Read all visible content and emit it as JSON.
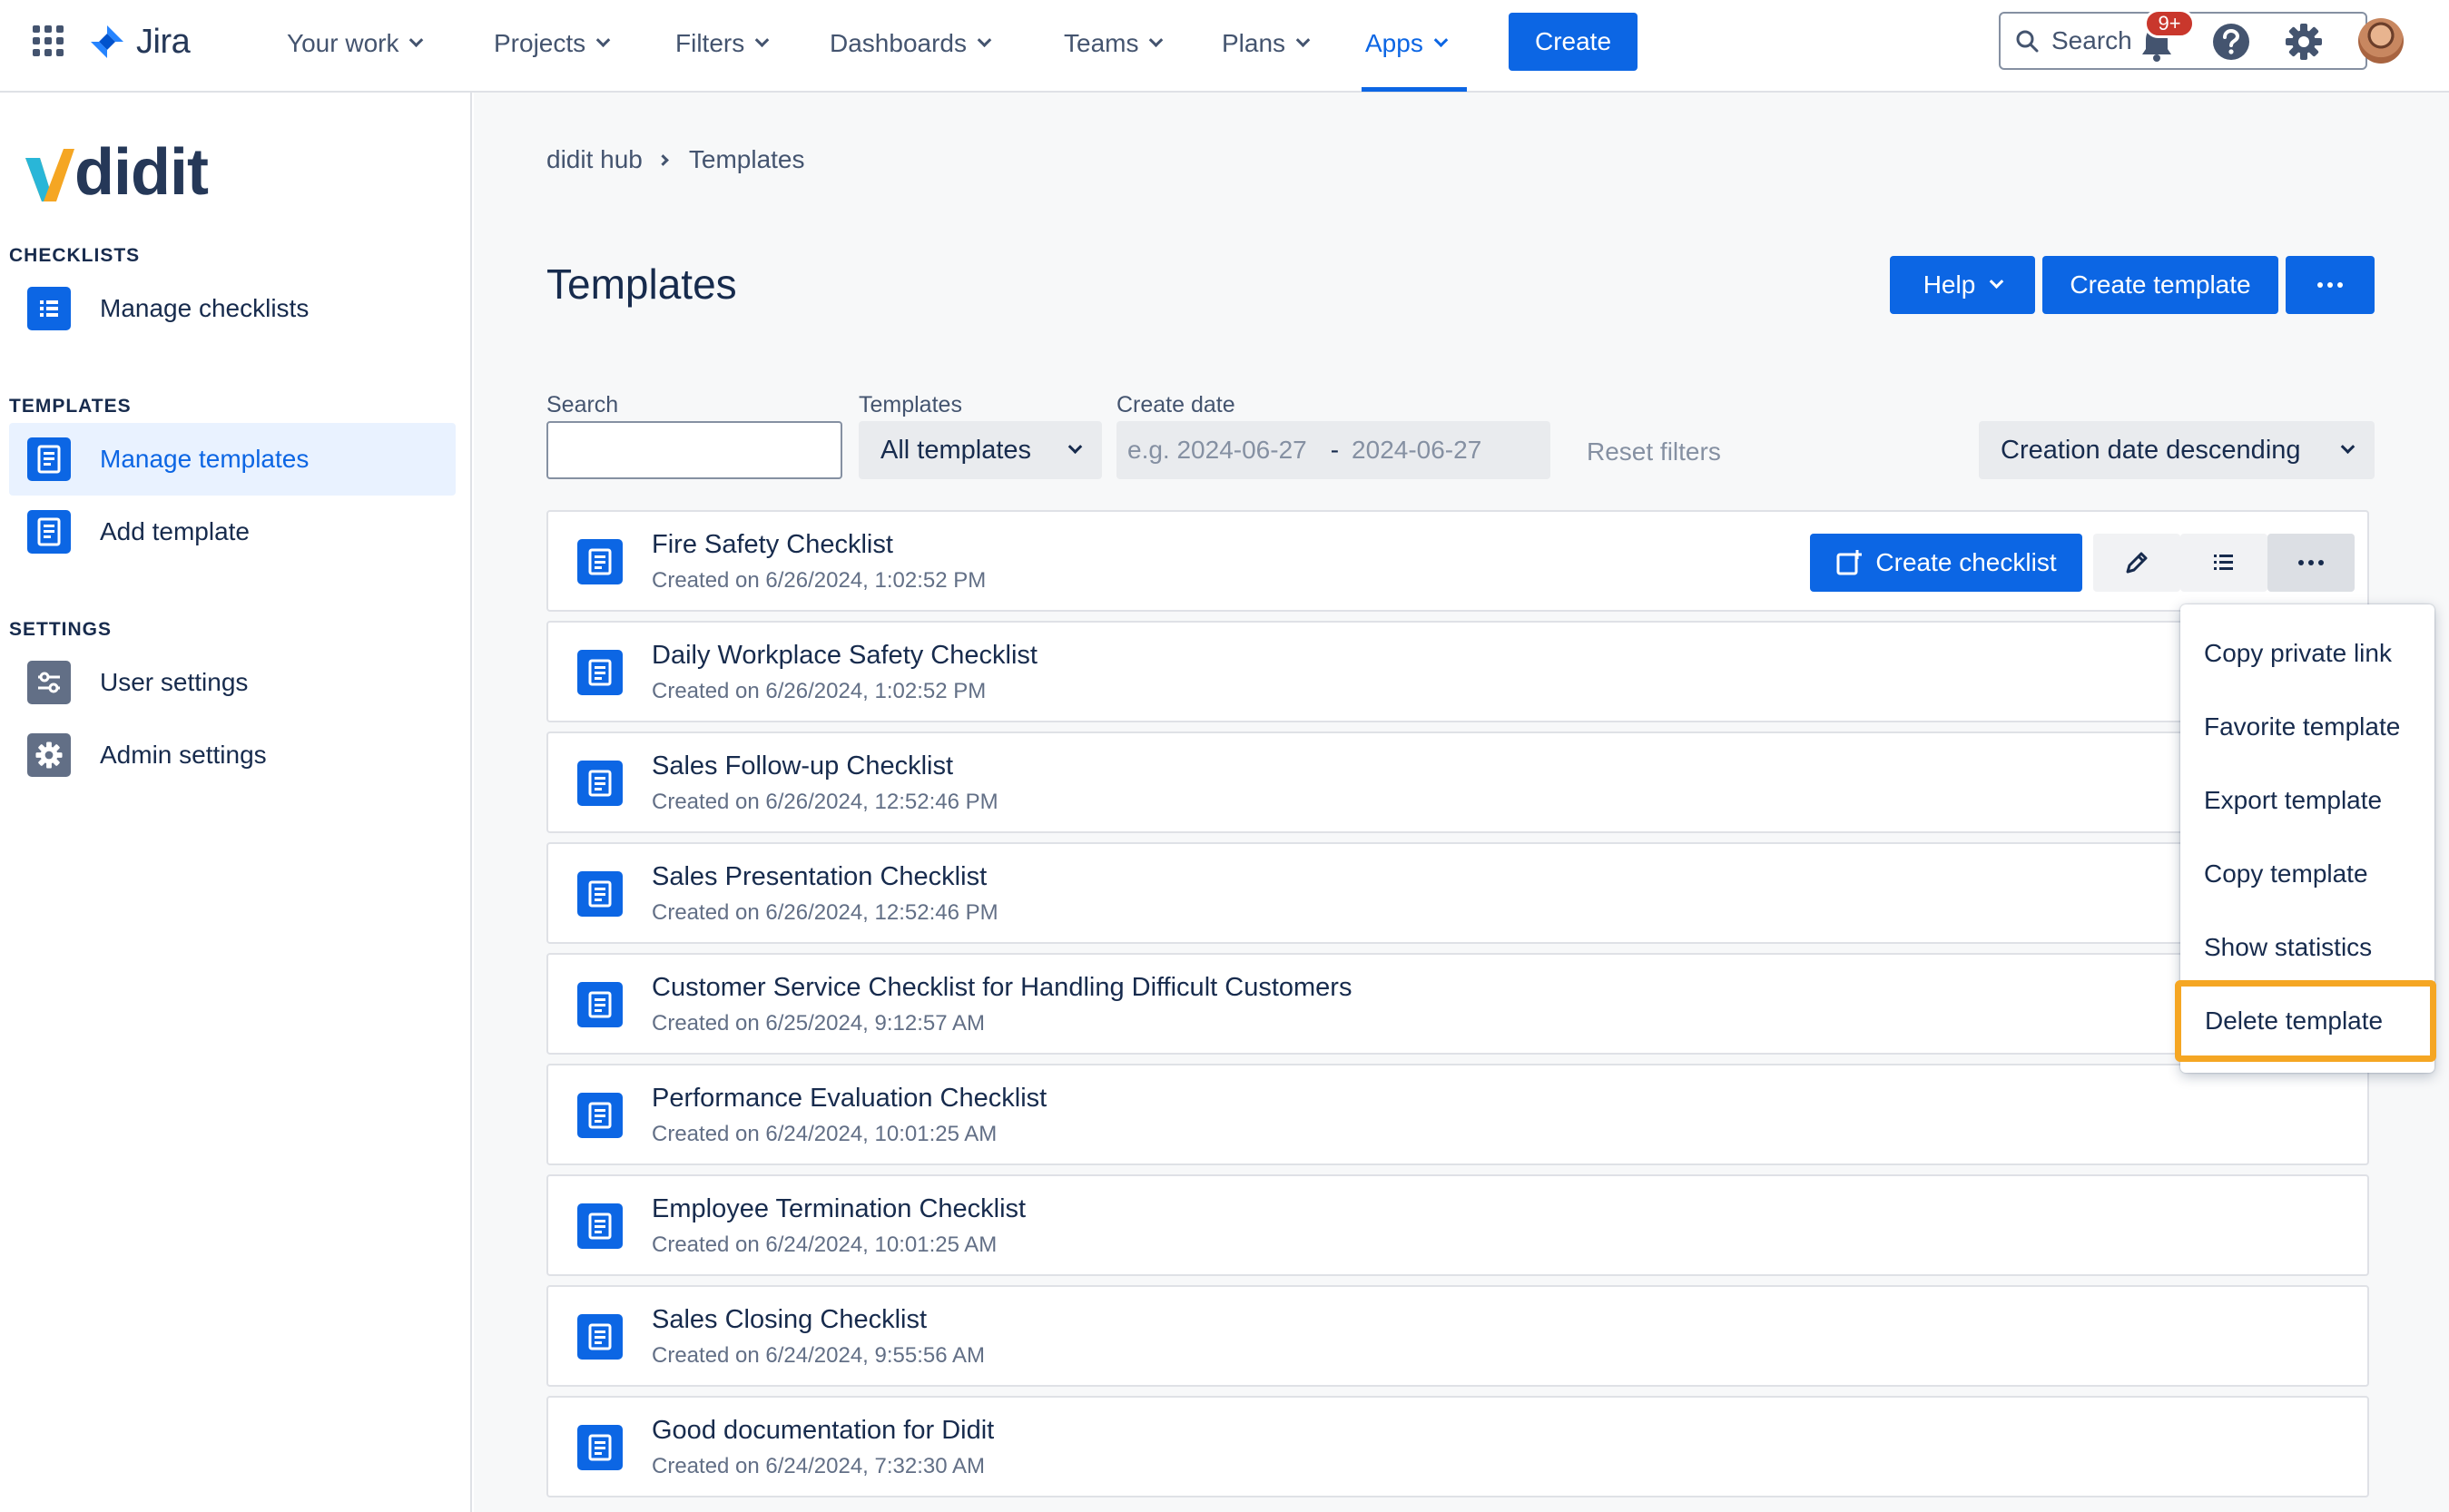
{
  "topnav": {
    "logo": "Jira",
    "items": [
      {
        "label": "Your work"
      },
      {
        "label": "Projects"
      },
      {
        "label": "Filters"
      },
      {
        "label": "Dashboards"
      },
      {
        "label": "Teams"
      },
      {
        "label": "Plans"
      },
      {
        "label": "Apps",
        "active": true
      }
    ],
    "create_label": "Create",
    "search_placeholder": "Search",
    "notification_badge": "9+",
    "accent": "#0C66E4"
  },
  "sidebar": {
    "logo": "didit",
    "sections": [
      {
        "heading": "CHECKLISTS",
        "items": [
          {
            "label": "Manage checklists",
            "icon": "list-icon"
          }
        ]
      },
      {
        "heading": "TEMPLATES",
        "items": [
          {
            "label": "Manage templates",
            "icon": "template-icon",
            "active": true
          },
          {
            "label": "Add template",
            "icon": "template-icon"
          }
        ]
      },
      {
        "heading": "SETTINGS",
        "items": [
          {
            "label": "User settings",
            "icon": "sliders-icon"
          },
          {
            "label": "Admin settings",
            "icon": "gear-icon"
          }
        ]
      }
    ]
  },
  "main": {
    "breadcrumb": [
      "didit hub",
      "Templates"
    ],
    "title": "Templates",
    "actions": {
      "help": "Help",
      "create_template": "Create template"
    },
    "filters": {
      "search_label": "Search",
      "templates_label": "Templates",
      "templates_value": "All templates",
      "date_label": "Create date",
      "date_from_placeholder": "e.g. 2024-06-27",
      "date_separator": "-",
      "date_to_placeholder": "2024-06-27",
      "reset": "Reset filters",
      "sort": "Creation date descending"
    },
    "row_action": {
      "create_checklist": "Create checklist"
    },
    "templates": [
      {
        "title": "Fire Safety Checklist",
        "created": "Created on 6/26/2024, 1:02:52 PM"
      },
      {
        "title": "Daily Workplace Safety Checklist",
        "created": "Created on 6/26/2024, 1:02:52 PM"
      },
      {
        "title": "Sales Follow-up Checklist",
        "created": "Created on 6/26/2024, 12:52:46 PM"
      },
      {
        "title": "Sales Presentation Checklist",
        "created": "Created on 6/26/2024, 12:52:46 PM"
      },
      {
        "title": "Customer Service Checklist for Handling Difficult Customers",
        "created": "Created on 6/25/2024, 9:12:57 AM"
      },
      {
        "title": "Performance Evaluation Checklist",
        "created": "Created on 6/24/2024, 10:01:25 AM"
      },
      {
        "title": "Employee Termination Checklist",
        "created": "Created on 6/24/2024, 10:01:25 AM"
      },
      {
        "title": "Sales Closing Checklist",
        "created": "Created on 6/24/2024, 9:55:56 AM"
      },
      {
        "title": "Good documentation for Didit",
        "created": "Created on 6/24/2024, 7:32:30 AM"
      }
    ],
    "menu": [
      {
        "label": "Copy private link"
      },
      {
        "label": "Favorite template"
      },
      {
        "label": "Export template"
      },
      {
        "label": "Copy template"
      },
      {
        "label": "Show statistics"
      },
      {
        "label": "Delete template",
        "highlighted": true
      }
    ],
    "highlight_color": "#F5A623"
  }
}
